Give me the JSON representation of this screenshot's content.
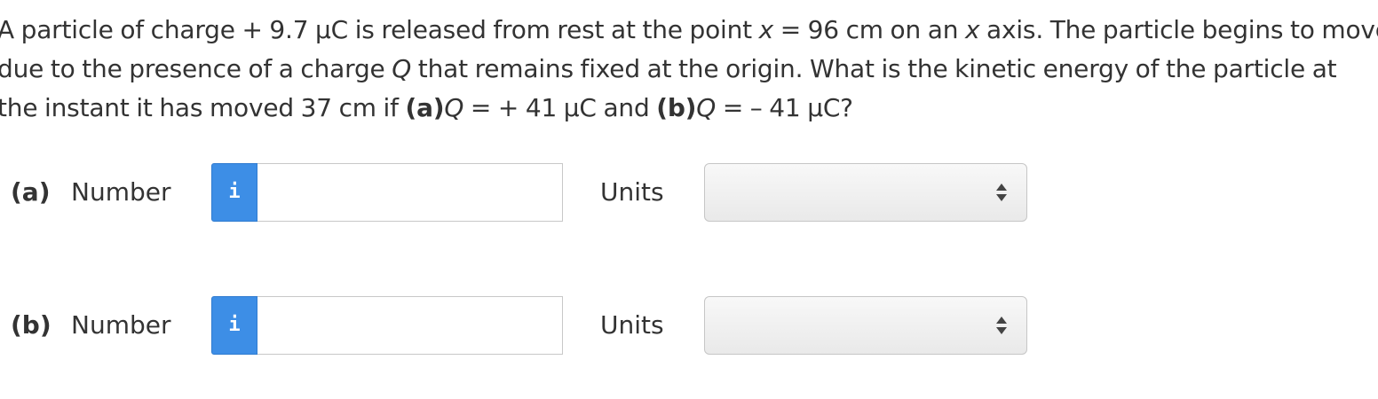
{
  "question": {
    "line1": {
      "t1": "A particle of charge + 9.7 μC is released from rest at the point ",
      "var_x": "x",
      "t2": " = 96 cm on an ",
      "var_x2": "x",
      "t3": " axis. The particle begins to move"
    },
    "line2": {
      "t1": "due to the presence of a charge ",
      "var_q": "Q",
      "t2": " that remains fixed at the origin. What is the kinetic energy of the particle at"
    },
    "line3": {
      "t1": "the instant it has moved 37 cm if ",
      "part_a": "(a)",
      "var_q_a": "Q",
      "t2": " = + 41 μC and ",
      "part_b": "(b)",
      "var_q_b": "Q",
      "t3": " = – 41 μC?"
    }
  },
  "answers": [
    {
      "part_label": "(a)",
      "number_label": "Number",
      "info_glyph": "i",
      "number_value": "",
      "units_label": "Units",
      "units_selected": ""
    },
    {
      "part_label": "(b)",
      "number_label": "Number",
      "info_glyph": "i",
      "number_value": "",
      "units_label": "Units",
      "units_selected": ""
    }
  ],
  "colors": {
    "info_button": "#3d8ee6",
    "text": "#333333",
    "input_border": "#c8c8c8"
  }
}
